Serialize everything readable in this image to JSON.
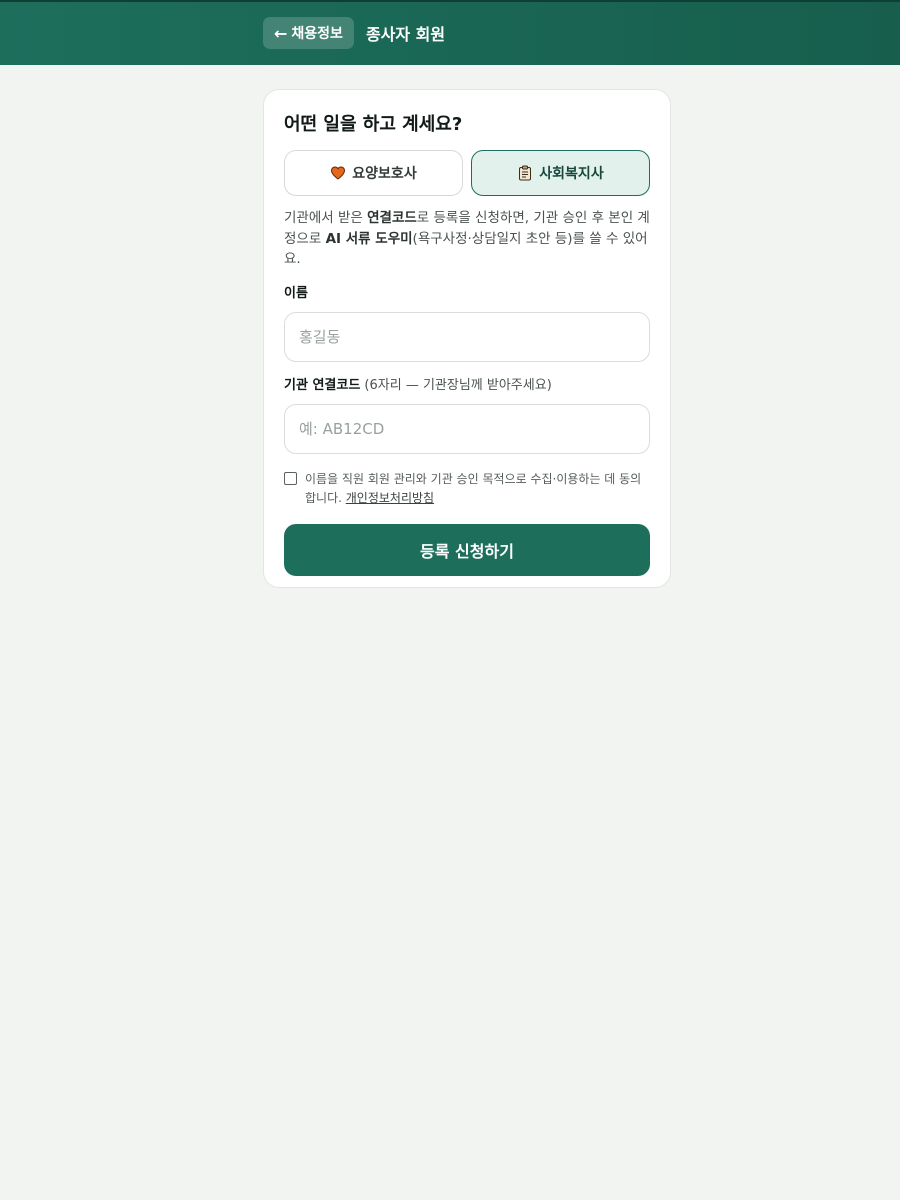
{
  "header": {
    "back_arrow": "←",
    "back_label": "채용정보",
    "title": "종사자 회원"
  },
  "card": {
    "question": "어떤 일을 하고 계세요?",
    "roles": [
      {
        "label": "요양보호사",
        "icon": "heart-icon",
        "selected": false
      },
      {
        "label": "사회복지사",
        "icon": "clipboard-icon",
        "selected": true
      }
    ],
    "description": {
      "part1": "기관에서 받은 ",
      "bold1": "연결코드",
      "part2": "로 등록을 신청하면, 기관 승인 후 본인 계정으로 ",
      "bold2": "AI 서류 도우미",
      "part3": "(욕구사정·상담일지 초안 등)를 쓸 수 있어요."
    },
    "name_field": {
      "label": "이름",
      "placeholder": "홍길동"
    },
    "code_field": {
      "label": "기관 연결코드",
      "hint": " (6자리 — 기관장님께 받아주세요)",
      "placeholder": "예: AB12CD"
    },
    "consent": {
      "checked": false,
      "text": "이름을 직원 회원 관리와 기관 승인 목적으로 수집·이용하는 데 동의합니다. ",
      "link": "개인정보처리방침"
    },
    "submit_label": "등록 신청하기"
  },
  "colors": {
    "brand": "#1d6f5c",
    "brand_dark": "#175e4d",
    "selected_bg": "#e3f1ec",
    "page_bg": "#f2f4f1",
    "heart": "#e8661a"
  }
}
